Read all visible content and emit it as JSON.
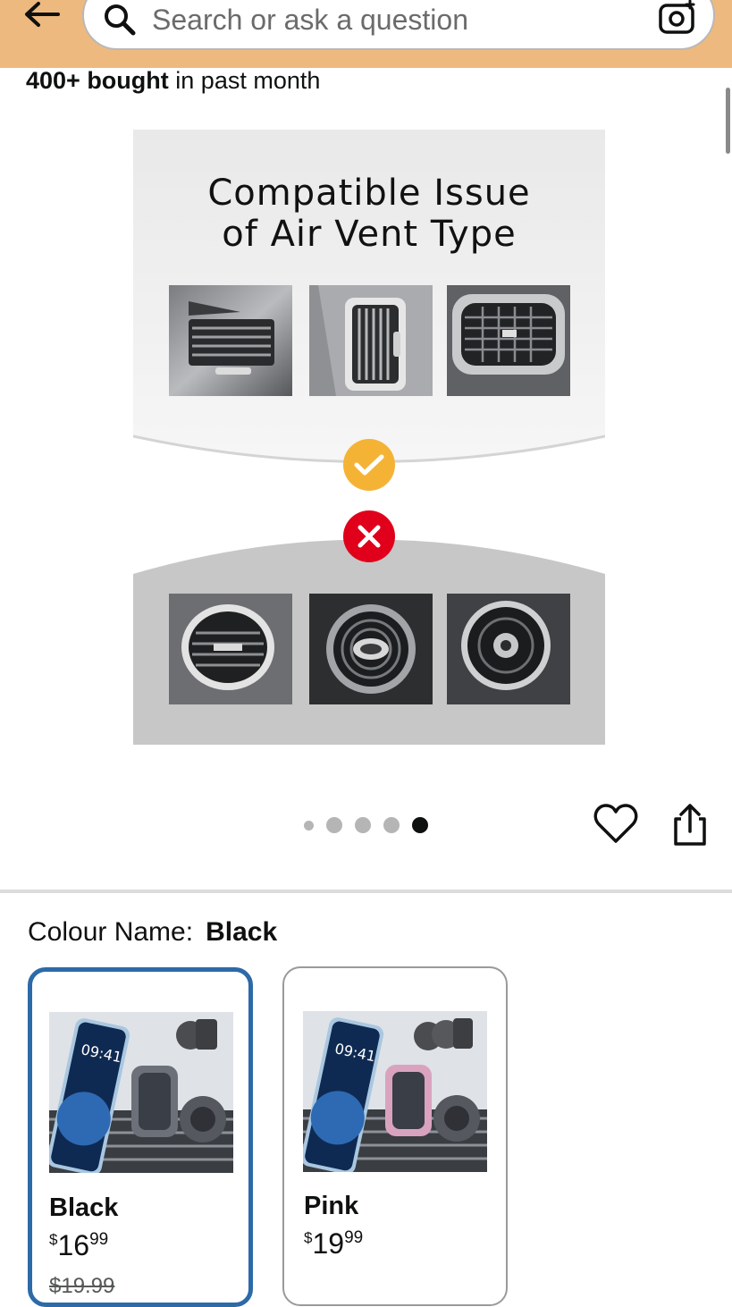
{
  "search": {
    "placeholder": "Search or ask a question"
  },
  "product": {
    "bought_bold": "400+ bought",
    "bought_rest": " in past month",
    "image_title_line1": "Compatible Issue",
    "image_title_line2": "of Air Vent Type",
    "carousel_index": 5,
    "carousel_count": 5
  },
  "variants": {
    "label": "Colour Name:",
    "selected": "Black",
    "options": [
      {
        "name": "Black",
        "currency": "$",
        "whole": "16",
        "cents": "99",
        "old_price": "$19.99",
        "selected": true
      },
      {
        "name": "Pink",
        "currency": "$",
        "whole": "19",
        "cents": "99",
        "selected": false
      }
    ]
  },
  "colors": {
    "header_bg": "#eeb97e",
    "selected_border": "#2c6aa8",
    "check_badge": "#f5b335",
    "cross_badge": "#e1001b"
  }
}
